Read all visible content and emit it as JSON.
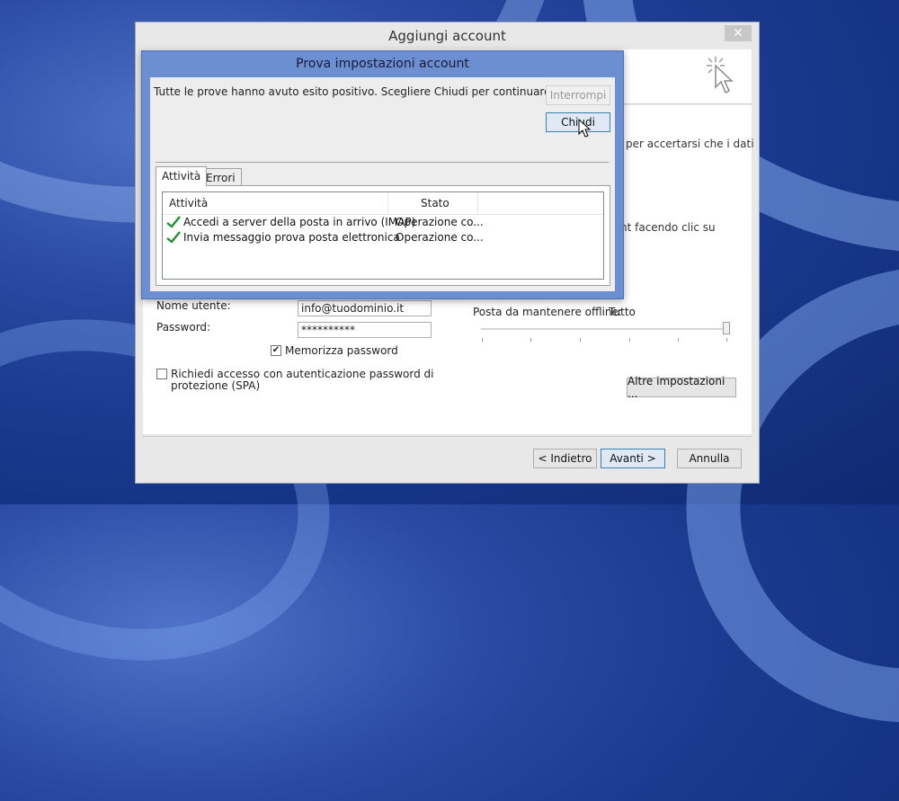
{
  "window": {
    "title": "Aggiungi account",
    "close_glyph": "✕"
  },
  "background_texts": {
    "accertarsi": "per accertarsi che i dati",
    "facendo_clic": "nt facendo clic su"
  },
  "form": {
    "username_label": "Nome utente:",
    "username_value": "info@tuodominio.it",
    "password_label": "Password:",
    "password_value": "**********",
    "remember_password_label": "Memorizza password",
    "remember_password_checked": "✔",
    "spa_label_line1": "Richiedi accesso con autenticazione password di",
    "spa_label_line2": "protezione (SPA)",
    "offline_label": "Posta da mantenere offline:",
    "offline_value": "Tutto",
    "more_settings_button": "Altre impostazioni ..."
  },
  "footer": {
    "back_button": "< Indietro",
    "next_button": "Avanti >",
    "cancel_button": "Annulla"
  },
  "modal": {
    "title": "Prova impostazioni account",
    "message": "Tutte le prove hanno avuto esito positivo. Scegliere Chiudi per continuare.",
    "stop_button": "Interrompi",
    "close_button": "Chiudi",
    "tabs": [
      "Attività",
      "Errori"
    ],
    "columns": [
      "Attività",
      "Stato"
    ],
    "rows": [
      {
        "task": "Accedi a server della posta in arrivo (IMAP)",
        "status": "Operazione co..."
      },
      {
        "task": "Invia messaggio prova posta elettronica",
        "status": "Operazione co..."
      }
    ]
  },
  "colors": {
    "check_green": "#1f8f2e",
    "modal_frame": "#6c8fd1",
    "desktop_blue": "#1a3a8f"
  },
  "icons": {
    "header": "cursor-sparkle-icon",
    "row_status": "checkmark-icon",
    "pointer": "mouse-cursor-icon"
  }
}
